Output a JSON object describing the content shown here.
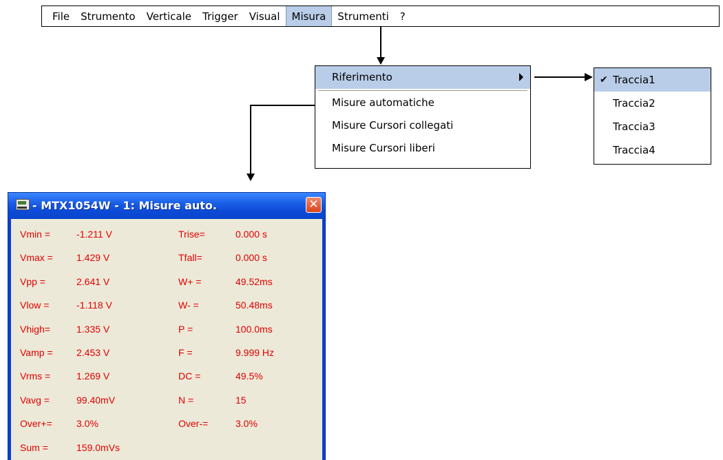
{
  "menubar": {
    "items": [
      "File",
      "Strumento",
      "Verticale",
      "Trigger",
      "Visual",
      "Misura",
      "Strumenti",
      "?"
    ],
    "active": "Misura"
  },
  "misura_menu": {
    "riferimento": "Riferimento",
    "automatiche": "Misure automatiche",
    "cursori_collegati": "Misure Cursori collegati",
    "cursori_liberi": "Misure Cursori liberi"
  },
  "traccia_menu": {
    "items": [
      "Traccia1",
      "Traccia2",
      "Traccia3",
      "Traccia4"
    ],
    "checked": "Traccia1",
    "check_glyph": "✔"
  },
  "window": {
    "title": " - MTX1054W - 1: Misure auto.",
    "close_glyph": "✕",
    "accent_color": "#0841d0",
    "text_color": "#e00000"
  },
  "measurements": {
    "left": [
      {
        "label": "Vmin =",
        "value": "-1.211 V"
      },
      {
        "label": "Vmax =",
        "value": "1.429 V"
      },
      {
        "label": "Vpp =",
        "value": "2.641 V"
      },
      {
        "label": "Vlow =",
        "value": "-1.118 V"
      },
      {
        "label": "Vhigh=",
        "value": "1.335 V"
      },
      {
        "label": "Vamp =",
        "value": "2.453 V"
      },
      {
        "label": "Vrms =",
        "value": "1.269 V"
      },
      {
        "label": "Vavg =",
        "value": "99.40mV"
      },
      {
        "label": "Over+=",
        "value": "3.0%"
      },
      {
        "label": "Sum =",
        "value": "159.0mVs"
      }
    ],
    "right": [
      {
        "label": "Trise=",
        "value": "0.000 s"
      },
      {
        "label": "Tfall=",
        "value": "0.000 s"
      },
      {
        "label": "W+ =",
        "value": "49.52ms"
      },
      {
        "label": "W- =",
        "value": "50.48ms"
      },
      {
        "label": "P =",
        "value": "100.0ms"
      },
      {
        "label": "F =",
        "value": "9.999 Hz"
      },
      {
        "label": "DC =",
        "value": "49.5%"
      },
      {
        "label": "N =",
        "value": "15"
      },
      {
        "label": "Over-=",
        "value": "3.0%"
      }
    ]
  }
}
